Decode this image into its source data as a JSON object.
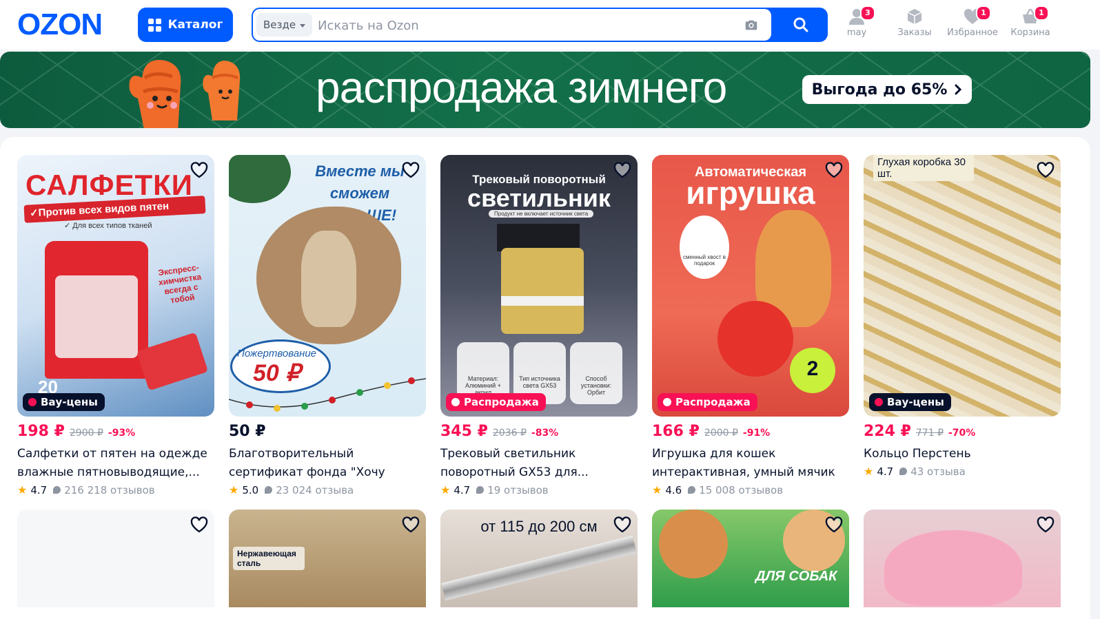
{
  "header": {
    "logo": "OZON",
    "catalog_label": "Каталог",
    "search": {
      "scope": "Везде",
      "placeholder": "Искать на Ozon"
    },
    "nav": [
      {
        "label": "may",
        "icon": "user-icon",
        "badge": "3"
      },
      {
        "label": "Заказы",
        "icon": "box-icon",
        "badge": ""
      },
      {
        "label": "Избранное",
        "icon": "heart-icon",
        "badge": "1"
      },
      {
        "label": "Корзина",
        "icon": "cart-icon",
        "badge": "1"
      }
    ]
  },
  "banner": {
    "title": "распродажа зимнего",
    "promo": "Выгода до 65%"
  },
  "colors": {
    "brand": "#005bff",
    "accent": "#f91155",
    "text": "#07112b",
    "muted": "#8d95a1"
  },
  "products": [
    {
      "tag": "Вау-цены",
      "price": "198 ₽",
      "old_price": "2900 ₽",
      "discount": "-93%",
      "title": "Салфетки от пятен на одежде влажные пятновыводящие,...",
      "rating": "4.7",
      "reviews": "216 218 отзывов",
      "image_text": {
        "headline": "САЛФЕТКИ",
        "sub": "✓Против всех видов пятен",
        "sub2": "✓ Для всех типов тканей",
        "badge": "Экспресс-химчистка всегда с тобой",
        "count": "20"
      }
    },
    {
      "tag": "",
      "price": "50 ₽",
      "old_price": "",
      "discount": "",
      "title": "Благотворительный сертификат фонда \"Хочу жить\"",
      "rating": "5.0",
      "reviews": "23 024 отзыва",
      "image_text": {
        "headline": "Вместе мы сможем БОЛЬШЕ!",
        "sub": "Пожертвование",
        "amount": "50 ₽"
      }
    },
    {
      "tag": "Распродажа",
      "price": "345 ₽",
      "old_price": "2036 ₽",
      "discount": "-83%",
      "title": "Трековый светильник поворотный GX53 для...",
      "rating": "4.7",
      "reviews": "19 отзывов",
      "image_text": {
        "headline": "Трековый поворотный",
        "headline2": "светильник",
        "sub": "Продукт не включает источник света",
        "f1": "Материал: Алюминий + акрил",
        "f2": "Тип источника света GX53",
        "f3": "Способ установки: Орбит"
      }
    },
    {
      "tag": "Распродажа",
      "price": "166 ₽",
      "old_price": "2000 ₽",
      "discount": "-91%",
      "title": "Игрушка для кошек интерактивная, умный мячик с...",
      "rating": "4.6",
      "reviews": "15 008 отзывов",
      "image_text": {
        "headline": "Автоматическая",
        "headline2": "игрушка",
        "sub": "сменный хвост в подарок",
        "mode": "2"
      }
    },
    {
      "tag": "Вау-цены",
      "price": "224 ₽",
      "old_price": "771 ₽",
      "discount": "-70%",
      "title": "Кольцо Перстень",
      "rating": "4.7",
      "reviews": "43 отзыва",
      "image_text": {
        "headline": "Глухая коробка 30 шт."
      }
    }
  ],
  "row2_image_text": {
    "card2": "Нержавеющая сталь",
    "card3": "от 115 до 200 см",
    "card4": "ДЛЯ СОБАК"
  }
}
